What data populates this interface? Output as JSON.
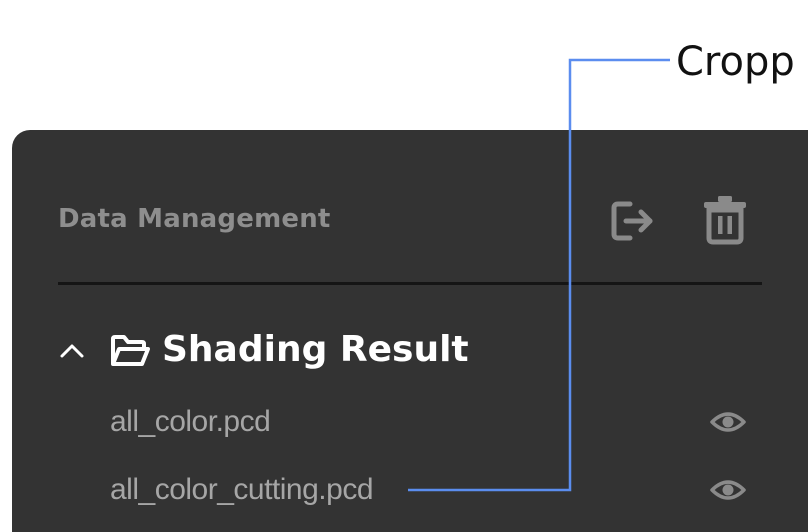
{
  "callout": {
    "label": "Cropp"
  },
  "panel": {
    "title": "Data Management",
    "toolbar": {
      "export_icon": "export-icon",
      "delete_icon": "trash-icon"
    }
  },
  "group": {
    "title": "Shading Result",
    "expanded": true,
    "chevron_icon": "chevron-up-icon",
    "folder_icon": "folder-open-icon",
    "files": [
      {
        "name": "all_color.pcd",
        "visibility_icon": "eye-icon"
      },
      {
        "name": "all_color_cutting.pcd",
        "visibility_icon": "eye-icon"
      }
    ]
  },
  "colors": {
    "panel_bg": "#333333",
    "callout_line": "#5b8def",
    "muted_text": "#8e8e8e",
    "file_text": "#a6a6a6",
    "icon_gray": "#8a8a8a"
  }
}
